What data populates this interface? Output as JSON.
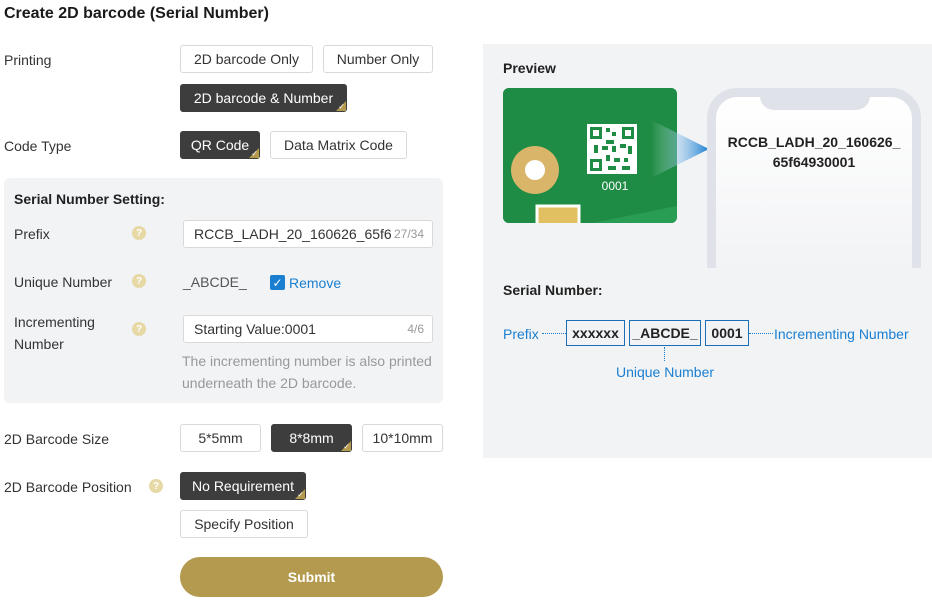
{
  "title": "Create 2D barcode (Serial Number)",
  "printing": {
    "label": "Printing",
    "options": [
      "2D barcode Only",
      "Number Only",
      "2D barcode & Number"
    ],
    "selected": "2D barcode & Number"
  },
  "code_type": {
    "label": "Code Type",
    "options": [
      "QR Code",
      "Data Matrix Code"
    ],
    "selected": "QR Code"
  },
  "serial_setting": {
    "heading": "Serial Number Setting:",
    "prefix_label": "Prefix",
    "prefix_value": "RCCB_LADH_20_160626_65f64",
    "prefix_count": "27/34",
    "unique_label": "Unique Number",
    "unique_value": "_ABCDE_",
    "remove_label": "Remove",
    "remove_checked": true,
    "incrementing_label": "Incrementing Number",
    "starting_value_label": "Starting Value:",
    "starting_value": "0001",
    "starting_count": "4/6",
    "hint": "The incrementing number is also printed underneath the 2D barcode."
  },
  "size": {
    "label": "2D Barcode Size",
    "options": [
      "5*5mm",
      "8*8mm",
      "10*10mm"
    ],
    "selected": "8*8mm"
  },
  "position": {
    "label": "2D Barcode Position",
    "options": [
      "No Requirement",
      "Specify Position"
    ],
    "selected": "No Requirement"
  },
  "submit_label": "Submit",
  "preview": {
    "heading": "Preview",
    "board_number": "0001",
    "phone_text": "RCCB_LADH_20_160626_65f64930001",
    "serial_heading": "Serial Number:",
    "prefix_label": "Prefix",
    "box_prefix": "xxxxxx",
    "box_unique": "_ABCDE_",
    "box_incrementing": "0001",
    "incrementing_label": "Incrementing Number",
    "unique_label": "Unique Number"
  },
  "colors": {
    "accent": "#b39a4e",
    "selected_bg": "#3d3d3d",
    "link_blue": "#1a7fd1",
    "board_green": "#1f8c45"
  }
}
